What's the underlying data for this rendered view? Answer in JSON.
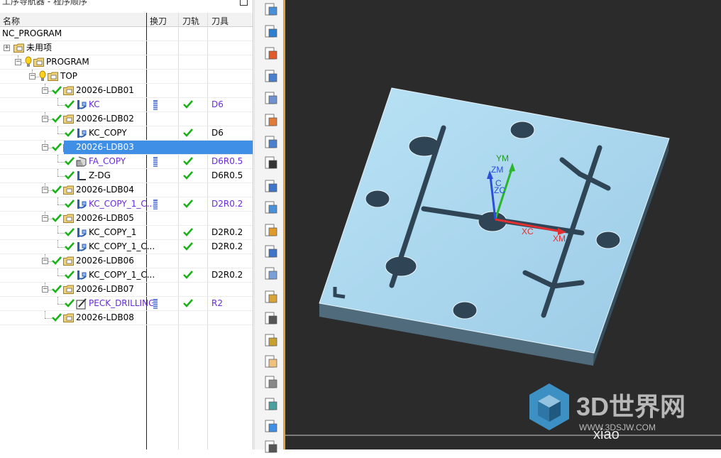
{
  "navigator": {
    "title": "工序导航器 - 程序顺序",
    "columns": {
      "name": "名称",
      "toolchange": "换刀",
      "path": "刀轨",
      "tool": "刀具"
    },
    "rows": [
      {
        "label": "NC_PROGRAM",
        "tool": ""
      },
      {
        "label": "未用项",
        "tool": ""
      },
      {
        "label": "PROGRAM",
        "tool": ""
      },
      {
        "label": "TOP",
        "tool": ""
      },
      {
        "label": "20026-LDB01",
        "tool": ""
      },
      {
        "label": "KC",
        "tool": "D6"
      },
      {
        "label": "20026-LDB02",
        "tool": ""
      },
      {
        "label": "KC_COPY",
        "tool": "D6"
      },
      {
        "label": "20026-LDB03",
        "tool": ""
      },
      {
        "label": "FA_COPY",
        "tool": "D6R0.5"
      },
      {
        "label": "Z-DG",
        "tool": "D6R0.5"
      },
      {
        "label": "20026-LDB04",
        "tool": ""
      },
      {
        "label": "KC_COPY_1_C...",
        "tool": "D2R0.2"
      },
      {
        "label": "20026-LDB05",
        "tool": ""
      },
      {
        "label": "KC_COPY_1",
        "tool": "D2R0.2"
      },
      {
        "label": "KC_COPY_1_C...",
        "tool": "D2R0.2"
      },
      {
        "label": "20026-LDB06",
        "tool": ""
      },
      {
        "label": "KC_COPY_1_C...",
        "tool": "D2R0.2"
      },
      {
        "label": "20026-LDB07",
        "tool": ""
      },
      {
        "label": "PECK_DRILLING",
        "tool": "R2"
      },
      {
        "label": "20026-LDB08",
        "tool": ""
      }
    ],
    "selected_row": "20026-LDB03"
  },
  "viewport": {
    "axes": {
      "ym": "YM",
      "zm": "ZM",
      "c": "C",
      "zc": "ZC",
      "xc": "XC",
      "xm": "XM"
    },
    "watermark": {
      "logo": "3D世界网",
      "url": "WWW.3DSJW.COM",
      "user": "xiao"
    }
  },
  "colors": {
    "selection": "#3f8fe6",
    "accent_edge": "#e8a23a",
    "viewport_bg": "#2b2b2b",
    "part": "#a9d6ee",
    "check": "#19b319"
  }
}
